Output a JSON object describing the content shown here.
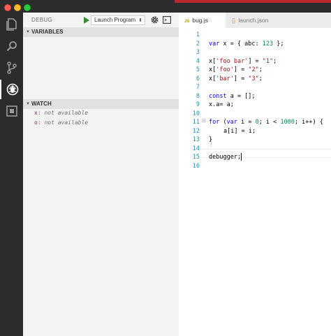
{
  "debug": {
    "title": "DEBUG",
    "config_selected": "Launch Program",
    "sections": {
      "variables": "VARIABLES",
      "watch": "WATCH"
    },
    "watch": [
      {
        "name": "x",
        "value": "not available"
      },
      {
        "name": "o",
        "value": "not available"
      }
    ]
  },
  "tabs": [
    {
      "label": "bug.js",
      "badge": "JS"
    },
    {
      "label": "launch.json",
      "badge": "{}"
    }
  ],
  "code": {
    "line_numbers": [
      "1",
      "2",
      "3",
      "4",
      "5",
      "6",
      "7",
      "8",
      "9",
      "10",
      "11",
      "12",
      "13",
      "14",
      "15",
      "16"
    ],
    "l2": {
      "a": "var",
      "b": " x = { abc: ",
      "c": "123",
      "d": " };"
    },
    "l4": {
      "a": "x[",
      "b": "'foo bar'",
      "c": "] = ",
      "d": "\"1\"",
      "e": ";"
    },
    "l5": {
      "a": "x[",
      "b": "'foo'",
      "c": "] = ",
      "d": "\"2\"",
      "e": ";"
    },
    "l6": {
      "a": "x[",
      "b": "'bar'",
      "c": "] = ",
      "d": "\"3\"",
      "e": ";"
    },
    "l8": {
      "a": "const",
      "b": " a = [];"
    },
    "l9": "x.a= a;",
    "l11": {
      "a": "for",
      "b": " (",
      "c": "var",
      "d": " i = ",
      "e": "0",
      "f": "; i < ",
      "g": "1000",
      "h": "; i++) {"
    },
    "l12": "a[i] = i;",
    "l13": "}",
    "l15": "debugger;"
  },
  "colors": {
    "activitybar": "#2c2c2c",
    "sidebar": "#f3f3f3",
    "keyword": "#0000ff",
    "string": "#a31515",
    "number": "#09885a",
    "line_number": "#2b91af"
  }
}
